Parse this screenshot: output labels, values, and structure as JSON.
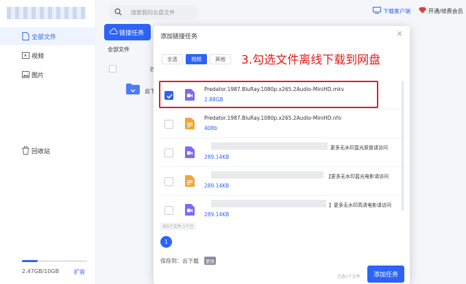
{
  "sidebar": {
    "items": [
      {
        "label": "全部文件",
        "icon": "file-icon"
      },
      {
        "label": "视频",
        "icon": "video-icon"
      },
      {
        "label": "图片",
        "icon": "image-icon"
      },
      {
        "label": "回收站",
        "icon": "trash-icon"
      }
    ],
    "storage": {
      "text": "2.47GB/10GB",
      "used_fraction": 0.247,
      "expand_label": "扩容"
    }
  },
  "header": {
    "search_placeholder": "搜索我的云盘文件",
    "download_client": "下载客户端",
    "vip": "开通/续费会员"
  },
  "main": {
    "link_task_button": "链接任务",
    "breadcrumb": "全部文件",
    "column_name": "名",
    "folder_name": "云下"
  },
  "dialog": {
    "title": "添加链接任务",
    "close": "×",
    "tabs": [
      {
        "label": "全选",
        "active": false
      },
      {
        "label": "视频",
        "active": true
      },
      {
        "label": "其他",
        "active": false
      }
    ],
    "annotation": "3.勾选文件离线下载到网盘",
    "files": [
      {
        "name": "Predator.1987.BluRay.1080p.x265.2Audio-MiniHD.mkv",
        "size": "2.88GB",
        "type": "video",
        "checked": true
      },
      {
        "name": "Predator.1987.BluRay.1080p.x265.2Audio-MiniHD.nfo",
        "size": "408b",
        "type": "doc",
        "checked": false
      },
      {
        "name_suffix": "更多无水印蓝光原盘请访问",
        "size": "289.14KB",
        "type": "video",
        "checked": false
      },
      {
        "name_suffix": "【更多无水印蓝光电影请访问",
        "size": "289.14KB",
        "type": "doc",
        "checked": false
      },
      {
        "name_suffix": "】更多无水印高清电影请访问",
        "size": "289.14KB",
        "type": "video",
        "checked": false
      }
    ],
    "selected_count": "共5个文件,1个已",
    "page": "1",
    "save_to_label": "保存到：云下载",
    "change_label": "更改",
    "summary": "已选1个文件",
    "add_button": "添加任务"
  },
  "colors": {
    "accent": "#2d63f6",
    "annotation": "#e21a1a",
    "video_icon": "#7b6cf6",
    "doc_icon": "#f2a53a"
  }
}
